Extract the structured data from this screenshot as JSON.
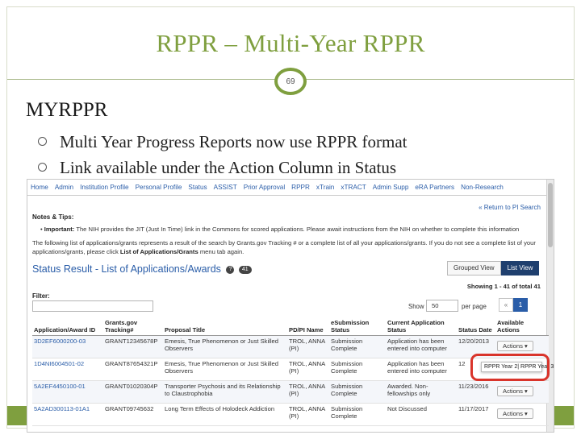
{
  "slide": {
    "title": "RPPR – Multi-Year RPPR",
    "page_number": "69",
    "heading": "MYRPPR",
    "bullets": [
      "Multi Year Progress Reports now use RPPR format",
      "Link available under the Action Column in Status"
    ],
    "accent_color": "#7f9f3f"
  },
  "web": {
    "nav": [
      "Home",
      "Admin",
      "Institution Profile",
      "Personal Profile",
      "Status",
      "ASSIST",
      "Prior Approval",
      "RPPR",
      "xTrain",
      "xTRACT",
      "Admin Supp",
      "eRA Partners",
      "Non-Research"
    ],
    "return_link": "« Return to PI Search",
    "notes_title": "Notes & Tips:",
    "important_label": "Important:",
    "important_text": "The NIH provides the JIT (Just In Time) link in the Commons for scored applications. Please await instructions from the NIH on whether to complete this information",
    "list_text": "The following list of applications/grants represents a result of the search by Grants.gov Tracking # or a complete list of all your applications/grants. If you do not see a complete list of your applications/grants, please click",
    "list_bold": "List of Applications/Grants",
    "list_tail": "menu tab again.",
    "status_title": "Status Result - List of Applications/Awards",
    "help_icon": "?",
    "result_count": "41",
    "view_grouped": "Grouped View",
    "view_list": "List View",
    "showing": "Showing 1 - 41 of total 41",
    "filter_label": "Filter:",
    "show_label": "Show",
    "show_value": "50",
    "per_page": "per page",
    "pager_prev": "«",
    "pager_current": "1",
    "pager_next": "»",
    "columns": [
      "Application/Award ID",
      "Grants.gov Tracking#",
      "Proposal Title",
      "PD/PI Name",
      "eSubmission Status",
      "Current Application Status",
      "Status Date",
      "Available Actions"
    ],
    "rows": [
      {
        "id": "3D2EF6000200-03",
        "tracking": "GRANT12345678P",
        "title": "Emesis, True Phenomenon or Just Skilled Observers",
        "pi": "TROL, ANNA (PI)",
        "esub": "Submission Complete",
        "status": "Application has been entered into computer",
        "date": "12/20/2013",
        "action": "Actions ▾"
      },
      {
        "id": "1D4NI6004501-02",
        "tracking": "GRANT87654321P",
        "title": "Emesis, True Phenomenon or Just Skilled Observers",
        "pi": "TROL, ANNA (PI)",
        "esub": "Submission Complete",
        "status": "Application has been entered into computer",
        "date": "12",
        "action": ""
      },
      {
        "id": "5A2EF4450100-01",
        "tracking": "GRANT01020304P",
        "title": "Transporter Psychosis and its Relationship to Claustrophobia",
        "pi": "TROL, ANNA (PI)",
        "esub": "Submission Complete",
        "status": "Awarded. Non-fellowships only",
        "date": "11/23/2016",
        "action": "Actions ▾"
      },
      {
        "id": "5A2AD300113-01A1",
        "tracking": "GRANT09745632",
        "title": "Long Term Effects of Holodeck Addiction",
        "pi": "TROL, ANNA (PI)",
        "esub": "Submission Complete",
        "status": "Not Discussed",
        "date": "11/17/2017",
        "action": "Actions ▾"
      }
    ],
    "dropdown_item": "RPPR Year 2| RPPR Year 3",
    "highlight_color": "#d9342b"
  }
}
